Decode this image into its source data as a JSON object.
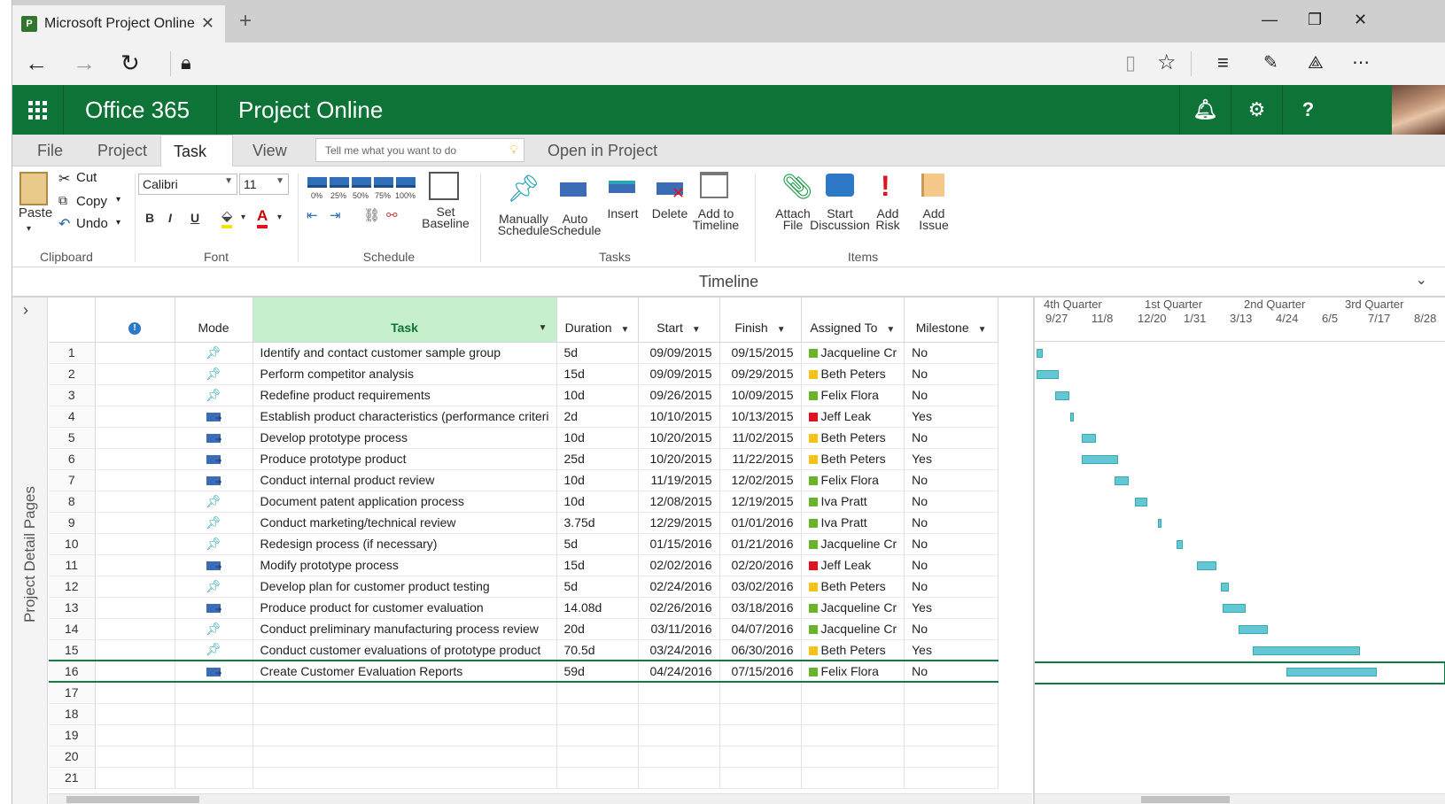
{
  "browser": {
    "tab_title": "Microsoft Project Online",
    "favicon_letter": "P"
  },
  "suite": {
    "brand": "Office 365",
    "app": "Project Online"
  },
  "ribbon_tabs": [
    "File",
    "Project",
    "Task",
    "View"
  ],
  "active_tab": "Task",
  "tellme_placeholder": "Tell me what you want to do",
  "open_in_project": "Open in Project",
  "clipboard": {
    "paste": "Paste",
    "cut": "Cut",
    "copy": "Copy",
    "undo": "Undo",
    "label": "Clipboard"
  },
  "font": {
    "family": "Calibri",
    "size": "11",
    "bold": "B",
    "italic": "I",
    "underline": "U",
    "label": "Font"
  },
  "schedule": {
    "pcts": [
      "0%",
      "25%",
      "50%",
      "75%",
      "100%"
    ],
    "set_baseline_1": "Set",
    "set_baseline_2": "Baseline",
    "label": "Schedule"
  },
  "tasks_group": {
    "manual_1": "Manually",
    "manual_2": "Schedule",
    "auto_1": "Auto",
    "auto_2": "Schedule",
    "insert": "Insert",
    "delete": "Delete",
    "add_tl_1": "Add to",
    "add_tl_2": "Timeline",
    "label": "Tasks"
  },
  "items_group": {
    "attach_1": "Attach",
    "attach_2": "File",
    "disc_1": "Start",
    "disc_2": "Discussion",
    "risk_1": "Add",
    "risk_2": "Risk",
    "issue_1": "Add",
    "issue_2": "Issue",
    "label": "Items"
  },
  "timeline_label": "Timeline",
  "rail_label": "Project Detail Pages",
  "columns": {
    "mode": "Mode",
    "task": "Task",
    "duration": "Duration",
    "start": "Start",
    "finish": "Finish",
    "assigned": "Assigned To",
    "milestone": "Milestone"
  },
  "rows": [
    {
      "n": "1",
      "mode": "manual",
      "task": "Identify and contact customer sample group",
      "duration": "5d",
      "start": "09/09/2015",
      "finish": "09/15/2015",
      "assigned": "Jacqueline Cr",
      "color": "#6ab42d",
      "milestone": "No"
    },
    {
      "n": "2",
      "mode": "manual",
      "task": "Perform competitor analysis",
      "duration": "15d",
      "start": "09/09/2015",
      "finish": "09/29/2015",
      "assigned": "Beth Peters",
      "color": "#f4c21b",
      "milestone": "No"
    },
    {
      "n": "3",
      "mode": "manual",
      "task": "Redefine product requirements",
      "duration": "10d",
      "start": "09/26/2015",
      "finish": "10/09/2015",
      "assigned": "Felix Flora",
      "color": "#6ab42d",
      "milestone": "No"
    },
    {
      "n": "4",
      "mode": "auto",
      "task": "Establish product characteristics (performance criteri",
      "duration": "2d",
      "start": "10/10/2015",
      "finish": "10/13/2015",
      "assigned": "Jeff Leak",
      "color": "#e0121e",
      "milestone": "Yes"
    },
    {
      "n": "5",
      "mode": "auto",
      "task": "Develop prototype process",
      "duration": "10d",
      "start": "10/20/2015",
      "finish": "11/02/2015",
      "assigned": "Beth Peters",
      "color": "#f4c21b",
      "milestone": "No"
    },
    {
      "n": "6",
      "mode": "auto",
      "task": "Produce prototype product",
      "duration": "25d",
      "start": "10/20/2015",
      "finish": "11/22/2015",
      "assigned": "Beth Peters",
      "color": "#f4c21b",
      "milestone": "Yes"
    },
    {
      "n": "7",
      "mode": "auto",
      "task": "Conduct internal product review",
      "duration": "10d",
      "start": "11/19/2015",
      "finish": "12/02/2015",
      "assigned": "Felix Flora",
      "color": "#6ab42d",
      "milestone": "No"
    },
    {
      "n": "8",
      "mode": "manual",
      "task": "Document patent application process",
      "duration": "10d",
      "start": "12/08/2015",
      "finish": "12/19/2015",
      "assigned": "Iva Pratt",
      "color": "#6ab42d",
      "milestone": "No"
    },
    {
      "n": "9",
      "mode": "manual",
      "task": "Conduct marketing/technical review",
      "duration": "3.75d",
      "start": "12/29/2015",
      "finish": "01/01/2016",
      "assigned": "Iva Pratt",
      "color": "#6ab42d",
      "milestone": "No"
    },
    {
      "n": "10",
      "mode": "manual",
      "task": "Redesign process (if necessary)",
      "duration": "5d",
      "start": "01/15/2016",
      "finish": "01/21/2016",
      "assigned": "Jacqueline Cr",
      "color": "#6ab42d",
      "milestone": "No"
    },
    {
      "n": "11",
      "mode": "auto",
      "task": "Modify prototype process",
      "duration": "15d",
      "start": "02/02/2016",
      "finish": "02/20/2016",
      "assigned": "Jeff Leak",
      "color": "#e0121e",
      "milestone": "No"
    },
    {
      "n": "12",
      "mode": "manual",
      "task": "Develop plan for customer product testing",
      "duration": "5d",
      "start": "02/24/2016",
      "finish": "03/02/2016",
      "assigned": "Beth Peters",
      "color": "#f4c21b",
      "milestone": "No"
    },
    {
      "n": "13",
      "mode": "auto",
      "task": "Produce product for customer evaluation",
      "duration": "14.08d",
      "start": "02/26/2016",
      "finish": "03/18/2016",
      "assigned": "Jacqueline Cr",
      "color": "#6ab42d",
      "milestone": "Yes"
    },
    {
      "n": "14",
      "mode": "manual",
      "task": "Conduct preliminary manufacturing process review",
      "duration": "20d",
      "start": "03/11/2016",
      "finish": "04/07/2016",
      "assigned": "Jacqueline Cr",
      "color": "#6ab42d",
      "milestone": "No"
    },
    {
      "n": "15",
      "mode": "manual",
      "task": "Conduct customer evaluations of prototype product",
      "duration": "70.5d",
      "start": "03/24/2016",
      "finish": "06/30/2016",
      "assigned": "Beth Peters",
      "color": "#f4c21b",
      "milestone": "Yes"
    },
    {
      "n": "16",
      "mode": "auto",
      "task": "Create Customer Evaluation Reports",
      "duration": "59d",
      "start": "04/24/2016",
      "finish": "07/15/2016",
      "assigned": "Felix Flora",
      "color": "#6ab42d",
      "milestone": "No"
    }
  ],
  "empty_rows": [
    "17",
    "18",
    "19",
    "20",
    "21"
  ],
  "gantt": {
    "quarters": [
      "4th Quarter",
      "1st Quarter",
      "2nd Quarter",
      "3rd Quarter"
    ],
    "months": [
      "9/27",
      "11/8",
      "12/20",
      "1/31",
      "3/13",
      "4/24",
      "6/5",
      "7/17",
      "8/28"
    ]
  }
}
